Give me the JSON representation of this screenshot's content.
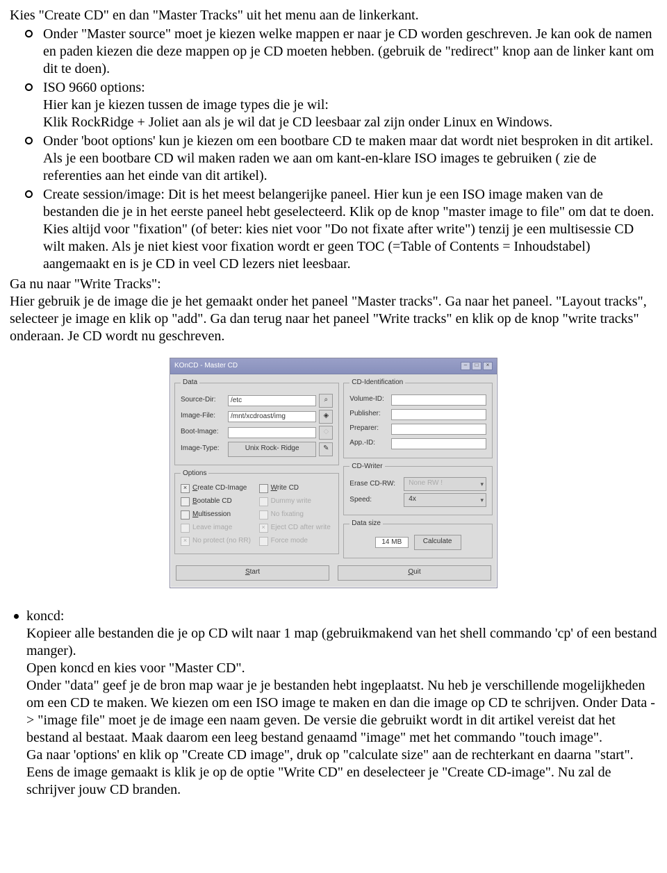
{
  "intro": "Kies \"Create CD\" en dan \"Master Tracks\" uit het menu aan de linkerkant.",
  "bullets": [
    "Onder \"Master source\" moet je kiezen welke mappen er naar je CD worden geschreven. Je kan ook de namen en paden kiezen die deze mappen op je CD moeten hebben. (gebruik de \"redirect\" knop aan de linker kant om dit te doen).",
    "ISO 9660 options:\nHier kan je kiezen tussen de image types die je wil:\nKlik RockRidge + Joliet aan als je wil dat je CD leesbaar zal zijn onder Linux en Windows.",
    "Onder 'boot options' kun je kiezen om een bootbare CD te maken maar dat wordt niet besproken in dit artikel. Als je een bootbare CD wil maken raden we aan om kant-en-klare ISO images te gebruiken ( zie de referenties aan het einde van dit artikel).",
    "Create session/image: Dit is het meest belangerijke paneel. Hier kun je een ISO image maken van de bestanden die je in het eerste paneel hebt geselecteerd. Klik op de knop \"master image to file\" om dat te doen.\nKies altijd voor \"fixation\" (of beter: kies niet voor \"Do not fixate after write\") tenzij je een multisessie CD wilt maken. Als je niet kiest voor fixation wordt er geen TOC (=Table of Contents = Inhoudstabel) aangemaakt en is je CD in veel CD lezers niet leesbaar."
  ],
  "after": "Ga nu naar \"Write Tracks\":\nHier gebruik je de image die je het gemaakt onder het paneel \"Master tracks\". Ga naar het paneel. \"Layout tracks\", selecteer je image en klik op \"add\". Ga dan terug naar het paneel \"Write tracks\" en klik op de knop \"write tracks\" onderaan. Je CD wordt nu geschreven.",
  "dialog": {
    "title": "KOnCD - Master CD",
    "data": {
      "legend": "Data",
      "sourceDirLabel": "Source-Dir:",
      "sourceDirValue": "/etc",
      "imageFileLabel": "Image-File:",
      "imageFileValue": "/mnt/xcdroast/img",
      "bootImageLabel": "Boot-Image:",
      "bootImageValue": "",
      "imageTypeLabel": "Image-Type:",
      "imageTypeValue": "Unix Rock- Ridge"
    },
    "options": {
      "legend": "Options",
      "createCDImage": "Create CD-Image",
      "writeCD": "Write CD",
      "bootableCD": "Bootable CD",
      "dummyWrite": "Dummy write",
      "multisession": "Multisession",
      "padTrack": "No fixating",
      "leaveImage": "Leave image",
      "ejectCD": "Eject CD after write",
      "noprotect": "No protect (no RR)",
      "forceMode": "Force mode"
    },
    "cdident": {
      "legend": "CD-Identification",
      "volumeId": "Volume-ID:",
      "publisher": "Publisher:",
      "preparer": "Preparer:",
      "appId": "App.-ID:"
    },
    "cdwriter": {
      "legend": "CD-Writer",
      "eraseLabel": "Erase CD-RW:",
      "eraseValue": "None RW !",
      "speedLabel": "Speed:",
      "speedValue": "4x"
    },
    "datasize": {
      "legend": "Data size",
      "value": "14 MB",
      "calcBtn": "Calculate"
    },
    "startBtn": "Start",
    "quitBtn": "Quit"
  },
  "koncd": {
    "heading": "koncd:",
    "body": "Kopieer alle bestanden die je op CD wilt naar 1 map (gebruikmakend van het shell commando 'cp' of een bestand manger).\nOpen koncd en kies voor \"Master CD\".\nOnder \"data\" geef je de bron map waar je je bestanden hebt ingeplaatst. Nu heb je verschillende mogelijkheden om een CD te maken. We kiezen om een ISO image te maken en dan die image op CD te schrijven. Onder Data -> \"image file\" moet je de image een naam geven. De versie die gebruikt wordt in dit artikel vereist dat het bestand al bestaat. Maak daarom een leeg bestand genaamd \"image\" met het commando \"touch image\".\nGa naar 'options' en klik op \"Create CD image\", druk op \"calculate size\" aan de rechterkant en daarna \"start\".\nEens de image gemaakt is klik je op de optie \"Write CD\" en deselecteer je \"Create CD-image\". Nu zal de schrijver jouw CD branden."
  }
}
